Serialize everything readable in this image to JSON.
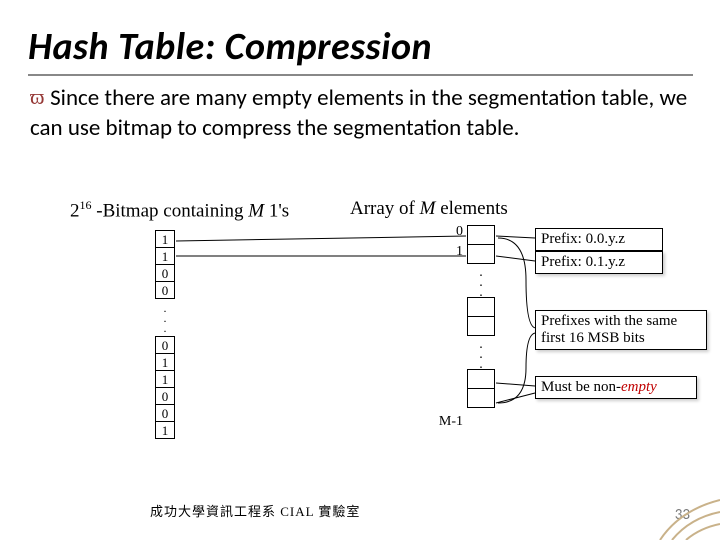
{
  "title": "Hash Table: Compression",
  "bullet": {
    "full": "Since there are many empty elements in the segmentation table, we can use bitmap to compress the segmentation table."
  },
  "cap_left_pre": "2",
  "cap_left_sup": "16",
  "cap_left_post": " -Bitmap containing ",
  "cap_left_M": "M",
  "cap_left_tail": " 1's",
  "cap_right_pre": "Array of ",
  "cap_right_M": "M",
  "cap_right_post": " elements",
  "bitmap_top": [
    "1",
    "1",
    "0",
    "0"
  ],
  "bitmap_bot": [
    "0",
    "1",
    "1",
    "0",
    "0",
    "1"
  ],
  "arr_labels": {
    "i0": "0",
    "i1": "1",
    "last": "M-1"
  },
  "side": {
    "p0": "Prefix: 0.0.y.z",
    "p1": "Prefix: 0.1.y.z",
    "same": "Prefixes with the same first 16 MSB bits",
    "must_pre": "Must be non-",
    "must_emp": "empty"
  },
  "footer": "成功大學資訊工程系   CIAL 實驗室",
  "slide_no": "33"
}
